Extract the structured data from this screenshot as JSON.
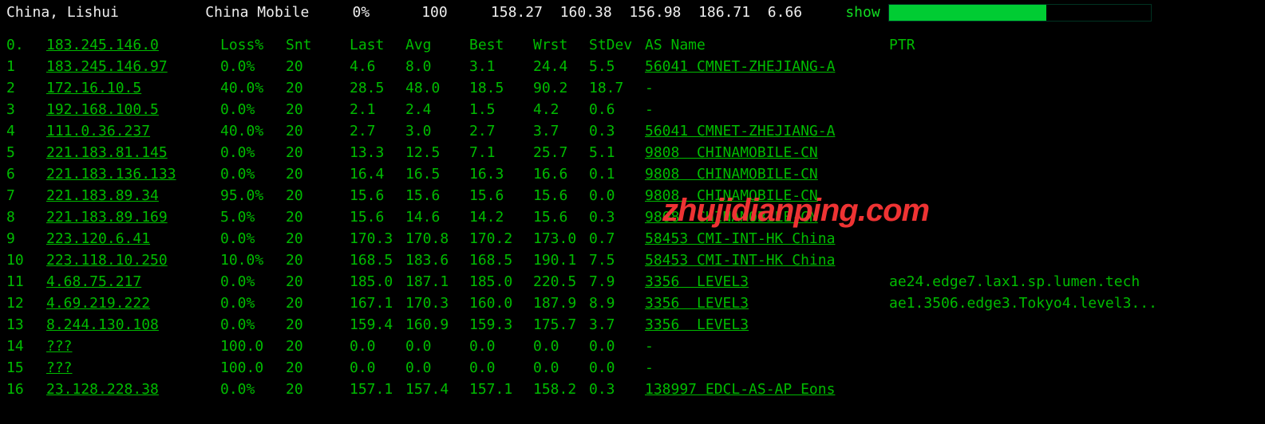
{
  "header": {
    "location": "China, Lishui",
    "provider": "China Mobile",
    "loss": "0%",
    "snt": "100",
    "last": "158.27",
    "avg": "160.38",
    "best": "156.98",
    "wrst": "186.71",
    "stdev": "6.66",
    "show": "show"
  },
  "columns": {
    "hop": "0.",
    "ip": "183.245.146.0",
    "loss": "Loss%",
    "snt": "Snt",
    "last": "Last",
    "avg": "Avg",
    "best": "Best",
    "wrst": "Wrst",
    "stdev": "StDev",
    "as": "AS Name",
    "ptr": "PTR"
  },
  "hops": [
    {
      "n": "1",
      "ip": "183.245.146.97",
      "loss": "0.0%",
      "snt": "20",
      "last": "4.6",
      "avg": "8.0",
      "best": "3.1",
      "wrst": "24.4",
      "stdev": "5.5",
      "as": "56041 CMNET-ZHEJIANG-A",
      "ptr": ""
    },
    {
      "n": "2",
      "ip": "172.16.10.5",
      "loss": "40.0%",
      "snt": "20",
      "last": "28.5",
      "avg": "48.0",
      "best": "18.5",
      "wrst": "90.2",
      "stdev": "18.7",
      "as": "-",
      "ptr": ""
    },
    {
      "n": "3",
      "ip": "192.168.100.5",
      "loss": "0.0%",
      "snt": "20",
      "last": "2.1",
      "avg": "2.4",
      "best": "1.5",
      "wrst": "4.2",
      "stdev": "0.6",
      "as": "-",
      "ptr": ""
    },
    {
      "n": "4",
      "ip": "111.0.36.237",
      "loss": "40.0%",
      "snt": "20",
      "last": "2.7",
      "avg": "3.0",
      "best": "2.7",
      "wrst": "3.7",
      "stdev": "0.3",
      "as": "56041 CMNET-ZHEJIANG-A",
      "ptr": ""
    },
    {
      "n": "5",
      "ip": "221.183.81.145",
      "loss": "0.0%",
      "snt": "20",
      "last": "13.3",
      "avg": "12.5",
      "best": "7.1",
      "wrst": "25.7",
      "stdev": "5.1",
      "as": "9808  CHINAMOBILE-CN",
      "ptr": ""
    },
    {
      "n": "6",
      "ip": "221.183.136.133",
      "loss": "0.0%",
      "snt": "20",
      "last": "16.4",
      "avg": "16.5",
      "best": "16.3",
      "wrst": "16.6",
      "stdev": "0.1",
      "as": "9808  CHINAMOBILE-CN",
      "ptr": ""
    },
    {
      "n": "7",
      "ip": "221.183.89.34",
      "loss": "95.0%",
      "snt": "20",
      "last": "15.6",
      "avg": "15.6",
      "best": "15.6",
      "wrst": "15.6",
      "stdev": "0.0",
      "as": "9808  CHINAMOBILE-CN",
      "ptr": ""
    },
    {
      "n": "8",
      "ip": "221.183.89.169",
      "loss": "5.0%",
      "snt": "20",
      "last": "15.6",
      "avg": "14.6",
      "best": "14.2",
      "wrst": "15.6",
      "stdev": "0.3",
      "as": "9808  CHINAMOBILE-CN",
      "ptr": ""
    },
    {
      "n": "9",
      "ip": "223.120.6.41",
      "loss": "0.0%",
      "snt": "20",
      "last": "170.3",
      "avg": "170.8",
      "best": "170.2",
      "wrst": "173.0",
      "stdev": "0.7",
      "as": "58453 CMI-INT-HK China",
      "ptr": ""
    },
    {
      "n": "10",
      "ip": "223.118.10.250",
      "loss": "10.0%",
      "snt": "20",
      "last": "168.5",
      "avg": "183.6",
      "best": "168.5",
      "wrst": "190.1",
      "stdev": "7.5",
      "as": "58453 CMI-INT-HK China",
      "ptr": ""
    },
    {
      "n": "11",
      "ip": "4.68.75.217",
      "loss": "0.0%",
      "snt": "20",
      "last": "185.0",
      "avg": "187.1",
      "best": "185.0",
      "wrst": "220.5",
      "stdev": "7.9",
      "as": "3356  LEVEL3",
      "ptr": "ae24.edge7.lax1.sp.lumen.tech"
    },
    {
      "n": "12",
      "ip": "4.69.219.222",
      "loss": "0.0%",
      "snt": "20",
      "last": "167.1",
      "avg": "170.3",
      "best": "160.0",
      "wrst": "187.9",
      "stdev": "8.9",
      "as": "3356  LEVEL3",
      "ptr": "ae1.3506.edge3.Tokyo4.level3..."
    },
    {
      "n": "13",
      "ip": "8.244.130.108",
      "loss": "0.0%",
      "snt": "20",
      "last": "159.4",
      "avg": "160.9",
      "best": "159.3",
      "wrst": "175.7",
      "stdev": "3.7",
      "as": "3356  LEVEL3",
      "ptr": ""
    },
    {
      "n": "14",
      "ip": "???",
      "loss": "100.0",
      "snt": "20",
      "last": "0.0",
      "avg": "0.0",
      "best": "0.0",
      "wrst": "0.0",
      "stdev": "0.0",
      "as": "-",
      "ptr": ""
    },
    {
      "n": "15",
      "ip": "???",
      "loss": "100.0",
      "snt": "20",
      "last": "0.0",
      "avg": "0.0",
      "best": "0.0",
      "wrst": "0.0",
      "stdev": "0.0",
      "as": "-",
      "ptr": ""
    },
    {
      "n": "16",
      "ip": "23.128.228.38",
      "loss": "0.0%",
      "snt": "20",
      "last": "157.1",
      "avg": "157.4",
      "best": "157.1",
      "wrst": "158.2",
      "stdev": "0.3",
      "as": "138997 EDCL-AS-AP Eons",
      "ptr": ""
    }
  ],
  "watermark": "zhujidianping.com"
}
